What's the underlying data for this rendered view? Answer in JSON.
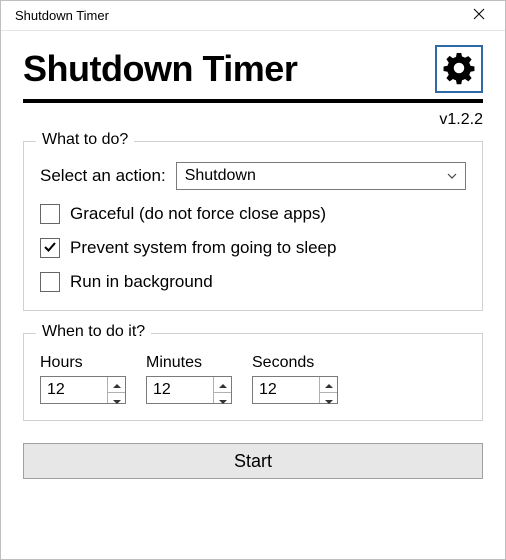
{
  "window": {
    "title": "Shutdown Timer"
  },
  "header": {
    "app_title": "Shutdown Timer",
    "version": "v1.2.2"
  },
  "what": {
    "legend": "What to do?",
    "select_label": "Select an action:",
    "selected_action": "Shutdown",
    "checks": {
      "graceful": {
        "label": "Graceful (do not force close apps)",
        "checked": false
      },
      "prevent_sleep": {
        "label": "Prevent system from going to sleep",
        "checked": true
      },
      "background": {
        "label": "Run in background",
        "checked": false
      }
    }
  },
  "when": {
    "legend": "When to do it?",
    "hours": {
      "label": "Hours",
      "value": "12"
    },
    "minutes": {
      "label": "Minutes",
      "value": "12"
    },
    "seconds": {
      "label": "Seconds",
      "value": "12"
    }
  },
  "footer": {
    "start_label": "Start"
  }
}
